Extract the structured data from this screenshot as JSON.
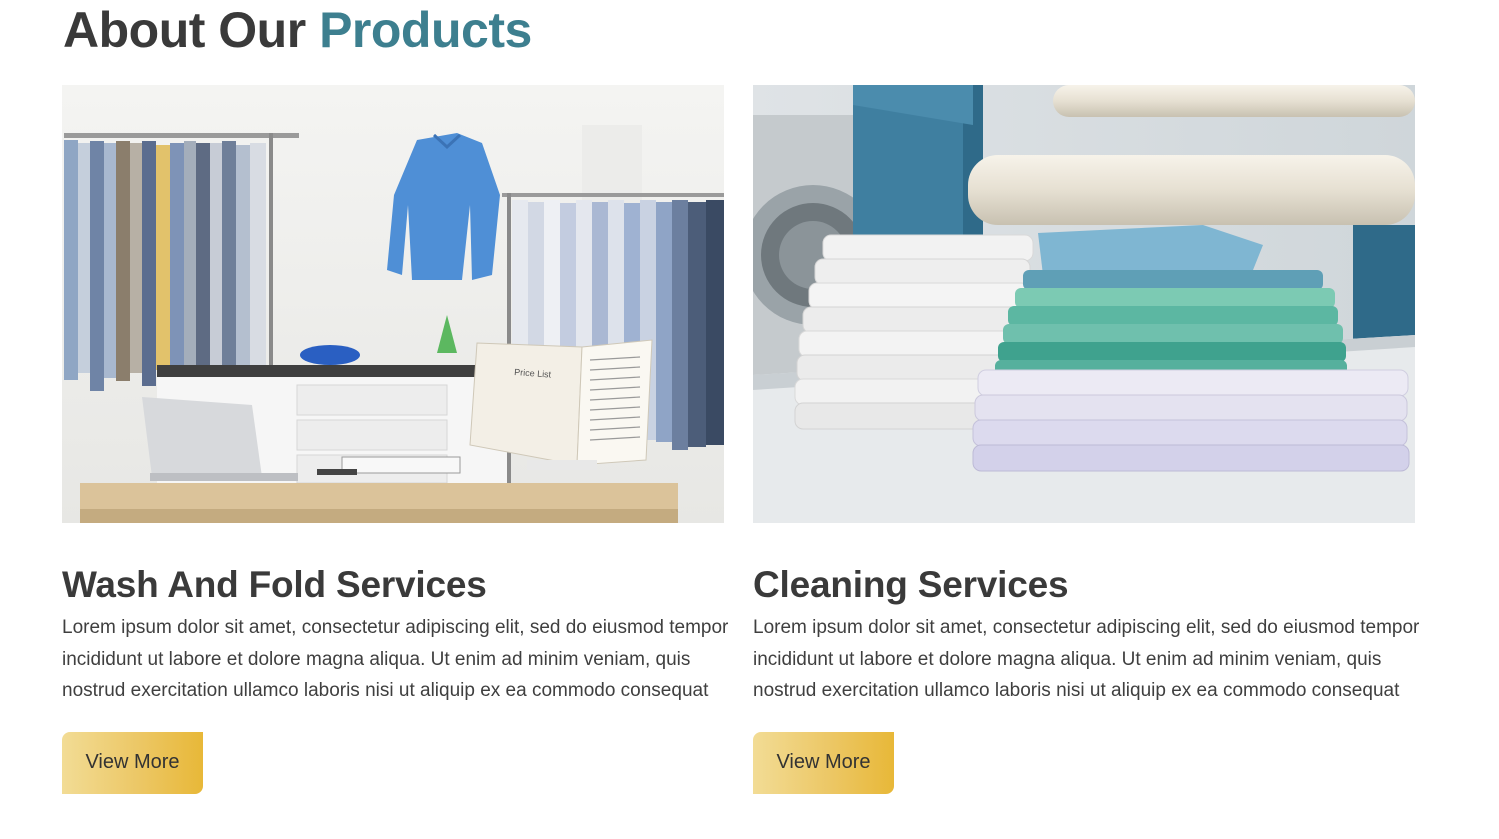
{
  "section": {
    "title_plain": "About Our",
    "title_accent": "Products"
  },
  "cards": [
    {
      "title": "Wash And Fold Services",
      "text": "Lorem ipsum dolor sit amet, consectetur adipiscing elit, sed do eiusmod tempor incididunt ut labore et dolore magna aliqua. Ut enim ad minim veniam, quis nostrud exercitation ullamco laboris nisi ut aliquip ex ea commodo consequat",
      "button_label": "View More",
      "image_overlay_text": "Price List"
    },
    {
      "title": "Cleaning Services",
      "text": "Lorem ipsum dolor sit amet, consectetur adipiscing elit, sed do eiusmod tempor incididunt ut labore et dolore magna aliqua. Ut enim ad minim veniam, quis nostrud exercitation ullamco laboris nisi ut aliquip ex ea commodo consequat",
      "button_label": "View More"
    }
  ],
  "colors": {
    "accent": "#3d7f8f",
    "heading": "#3a3a3a",
    "button_gradient_start": "#f2dc95",
    "button_gradient_end": "#e8b838"
  }
}
